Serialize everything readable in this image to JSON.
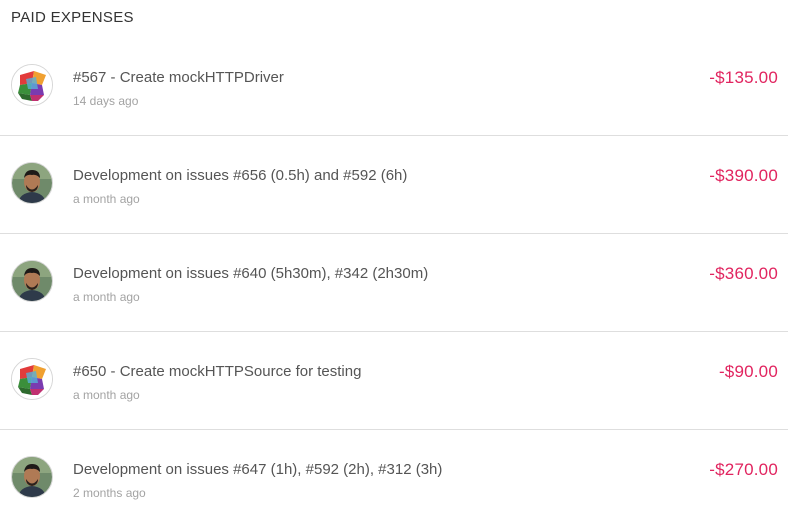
{
  "section": {
    "title": "PAID EXPENSES"
  },
  "expenses": [
    {
      "avatar_icon": "colorful-logo-avatar",
      "description": "#567 - Create mockHTTPDriver",
      "time": "14 days ago",
      "amount": "-$135.00"
    },
    {
      "avatar_icon": "person-photo-avatar",
      "description": "Development on issues #656 (0.5h) and #592 (6h)",
      "time": "a month ago",
      "amount": "-$390.00"
    },
    {
      "avatar_icon": "person-photo-avatar",
      "description": "Development on issues #640 (5h30m), #342 (2h30m)",
      "time": "a month ago",
      "amount": "-$360.00"
    },
    {
      "avatar_icon": "colorful-logo-avatar",
      "description": "#650 - Create mockHTTPSource for testing",
      "time": "a month ago",
      "amount": "-$90.00"
    },
    {
      "avatar_icon": "person-photo-avatar",
      "description": "Development on issues #647 (1h), #592 (2h), #312 (3h)",
      "time": "2 months ago",
      "amount": "-$270.00"
    }
  ],
  "colors": {
    "amount": "#e1245f",
    "secondary_text": "#a3a3a3",
    "divider": "#dedede"
  }
}
